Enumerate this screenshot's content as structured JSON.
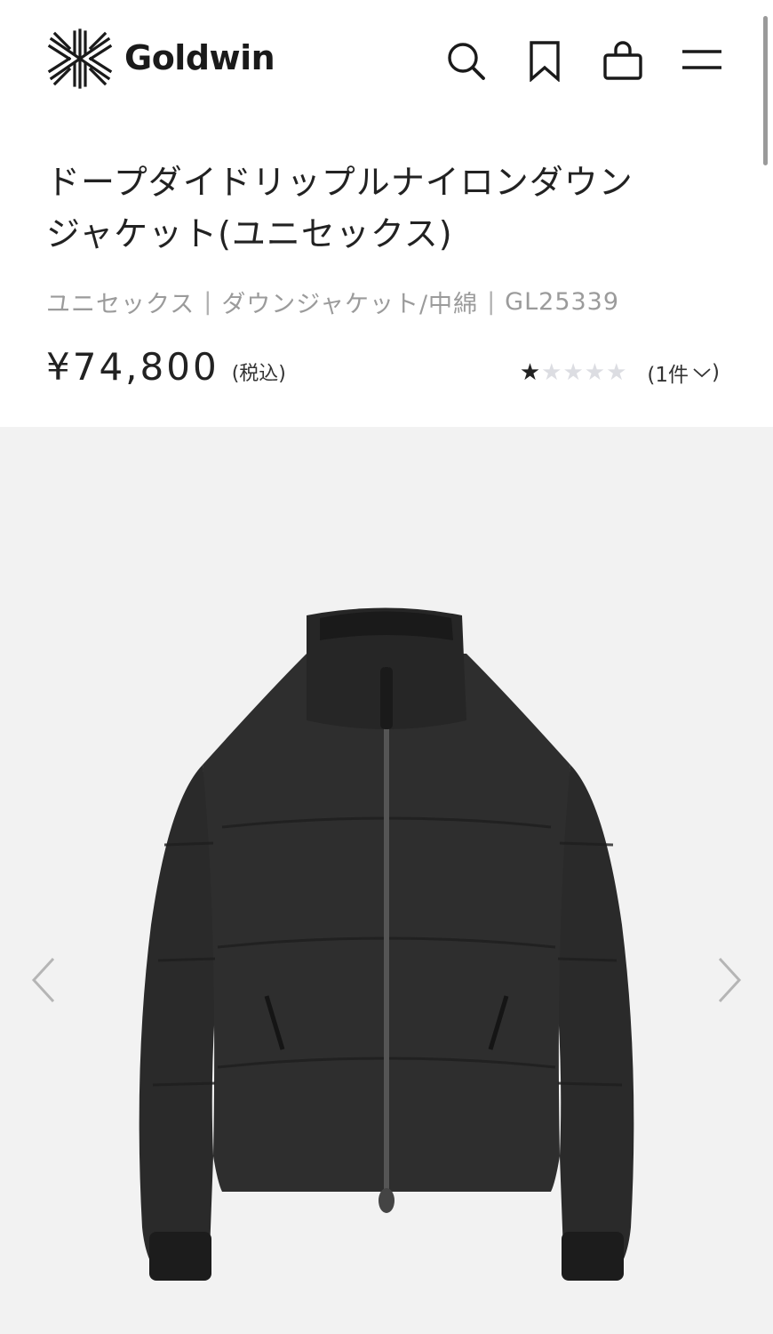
{
  "header": {
    "brand": "Goldwin",
    "icons": [
      "search-icon",
      "bookmark-icon",
      "shopping-bag-icon",
      "menu-icon"
    ]
  },
  "product": {
    "title_line1": "ドープダイドリップルナイロンダウン",
    "title_line2": "ジャケット(ユニセックス)",
    "breadcrumb": [
      "ユニセックス",
      "ダウンジャケット/中綿",
      "GL25339"
    ],
    "breadcrumb_separator": "|",
    "price": "¥74,800",
    "tax_note": "(税込)",
    "rating": {
      "value": 1,
      "max": 5
    },
    "review_count": "(1件"
  },
  "gallery": {
    "image_subject": "black down jacket",
    "prev_icon": "chevron-left-icon",
    "next_icon": "chevron-right-icon"
  },
  "colors": {
    "text": "#222222",
    "muted": "#9b9b9b",
    "gallery_bg": "#f2f2f2",
    "star_inactive": "#dcdde2"
  }
}
